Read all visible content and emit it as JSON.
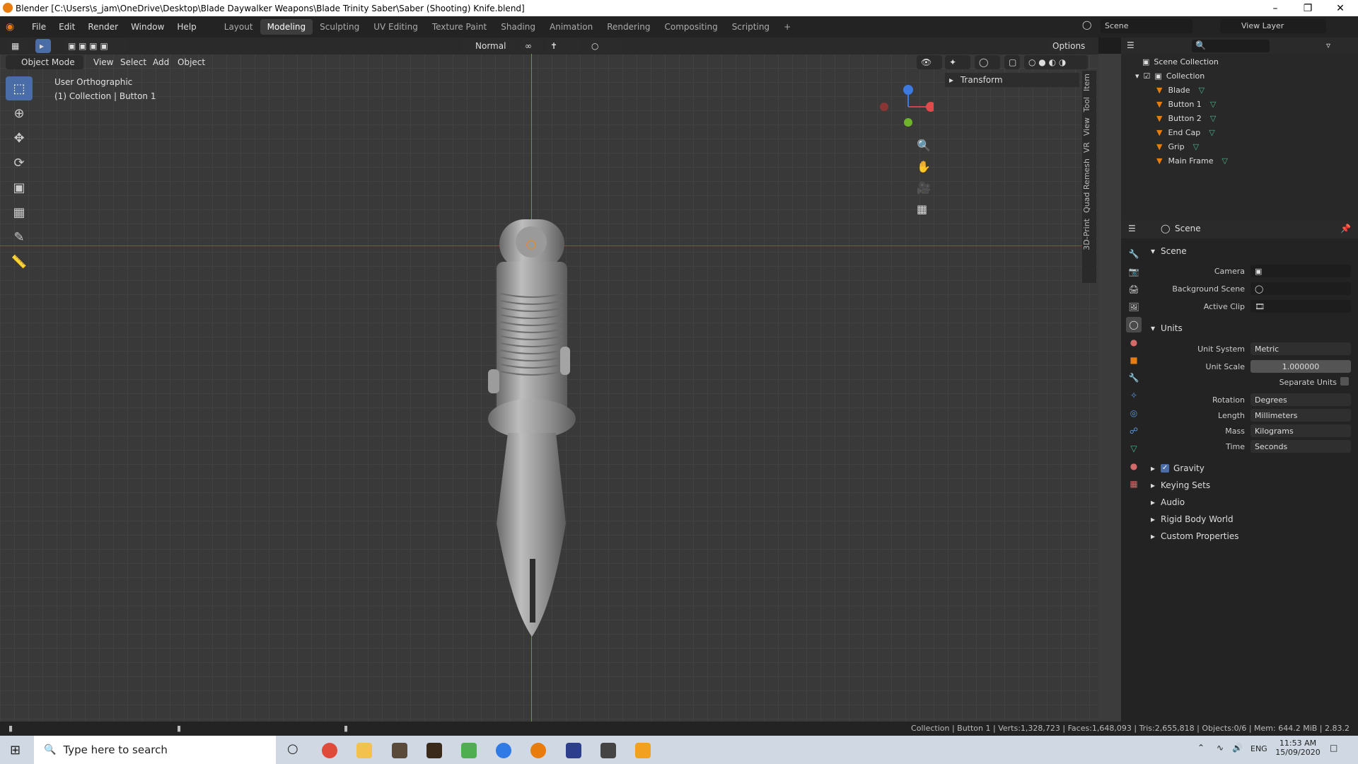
{
  "window": {
    "title": "Blender [C:\\Users\\s_jam\\OneDrive\\Desktop\\Blade Daywalker Weapons\\Blade Trinity Saber\\Saber (Shooting) Knife.blend]"
  },
  "menu": [
    "File",
    "Edit",
    "Render",
    "Window",
    "Help"
  ],
  "workspaces": [
    "Layout",
    "Modeling",
    "Sculpting",
    "UV Editing",
    "Texture Paint",
    "Shading",
    "Animation",
    "Rendering",
    "Compositing",
    "Scripting"
  ],
  "active_workspace": "Modeling",
  "scene_field": "Scene",
  "view_layer_field": "View Layer",
  "viewport": {
    "mode": "Object Mode",
    "menus": [
      "View",
      "Select",
      "Add",
      "Object"
    ],
    "orientation": "Normal",
    "options": "Options",
    "view_name": "User Orthographic",
    "collection_info": "(1) Collection | Button 1",
    "transform_panel": "Transform",
    "npanel_tabs": [
      "Item",
      "Tool",
      "View",
      "VR",
      "Quad Remesh",
      "3D-Print"
    ],
    "gizmo": {
      "x": "X",
      "y": "Y",
      "z": "Z"
    }
  },
  "outliner": {
    "root": "Scene Collection",
    "collection": "Collection",
    "objects": [
      "Blade",
      "Button 1",
      "Button 2",
      "End Cap",
      "Grip",
      "Main Frame"
    ]
  },
  "properties": {
    "header": "Scene",
    "scene_section": "Scene",
    "camera_label": "Camera",
    "background_scene_label": "Background Scene",
    "active_clip_label": "Active Clip",
    "units_section": "Units",
    "unit_system_label": "Unit System",
    "unit_system": "Metric",
    "unit_scale_label": "Unit Scale",
    "unit_scale": "1.000000",
    "separate_units_label": "Separate Units",
    "rotation_label": "Rotation",
    "rotation": "Degrees",
    "length_label": "Length",
    "length": "Millimeters",
    "mass_label": "Mass",
    "mass": "Kilograms",
    "time_label": "Time",
    "time": "Seconds",
    "collapsed_sections": [
      "Gravity",
      "Keying Sets",
      "Audio",
      "Rigid Body World",
      "Custom Properties"
    ],
    "gravity_checked": true
  },
  "status": "Collection | Button 1 | Verts:1,328,723 | Faces:1,648,093 | Tris:2,655,818 | Objects:0/6 | Mem: 644.2 MiB | 2.83.2",
  "taskbar": {
    "search_placeholder": "Type here to search",
    "lang": "ENG",
    "time": "11:53 AM",
    "date": "15/09/2020"
  },
  "colors": {
    "accent": "#4a6da8",
    "x_axis": "#e04a4a",
    "y_axis": "#6fb42a",
    "z_axis": "#3c79e0",
    "object_orange": "#e87d0d"
  }
}
